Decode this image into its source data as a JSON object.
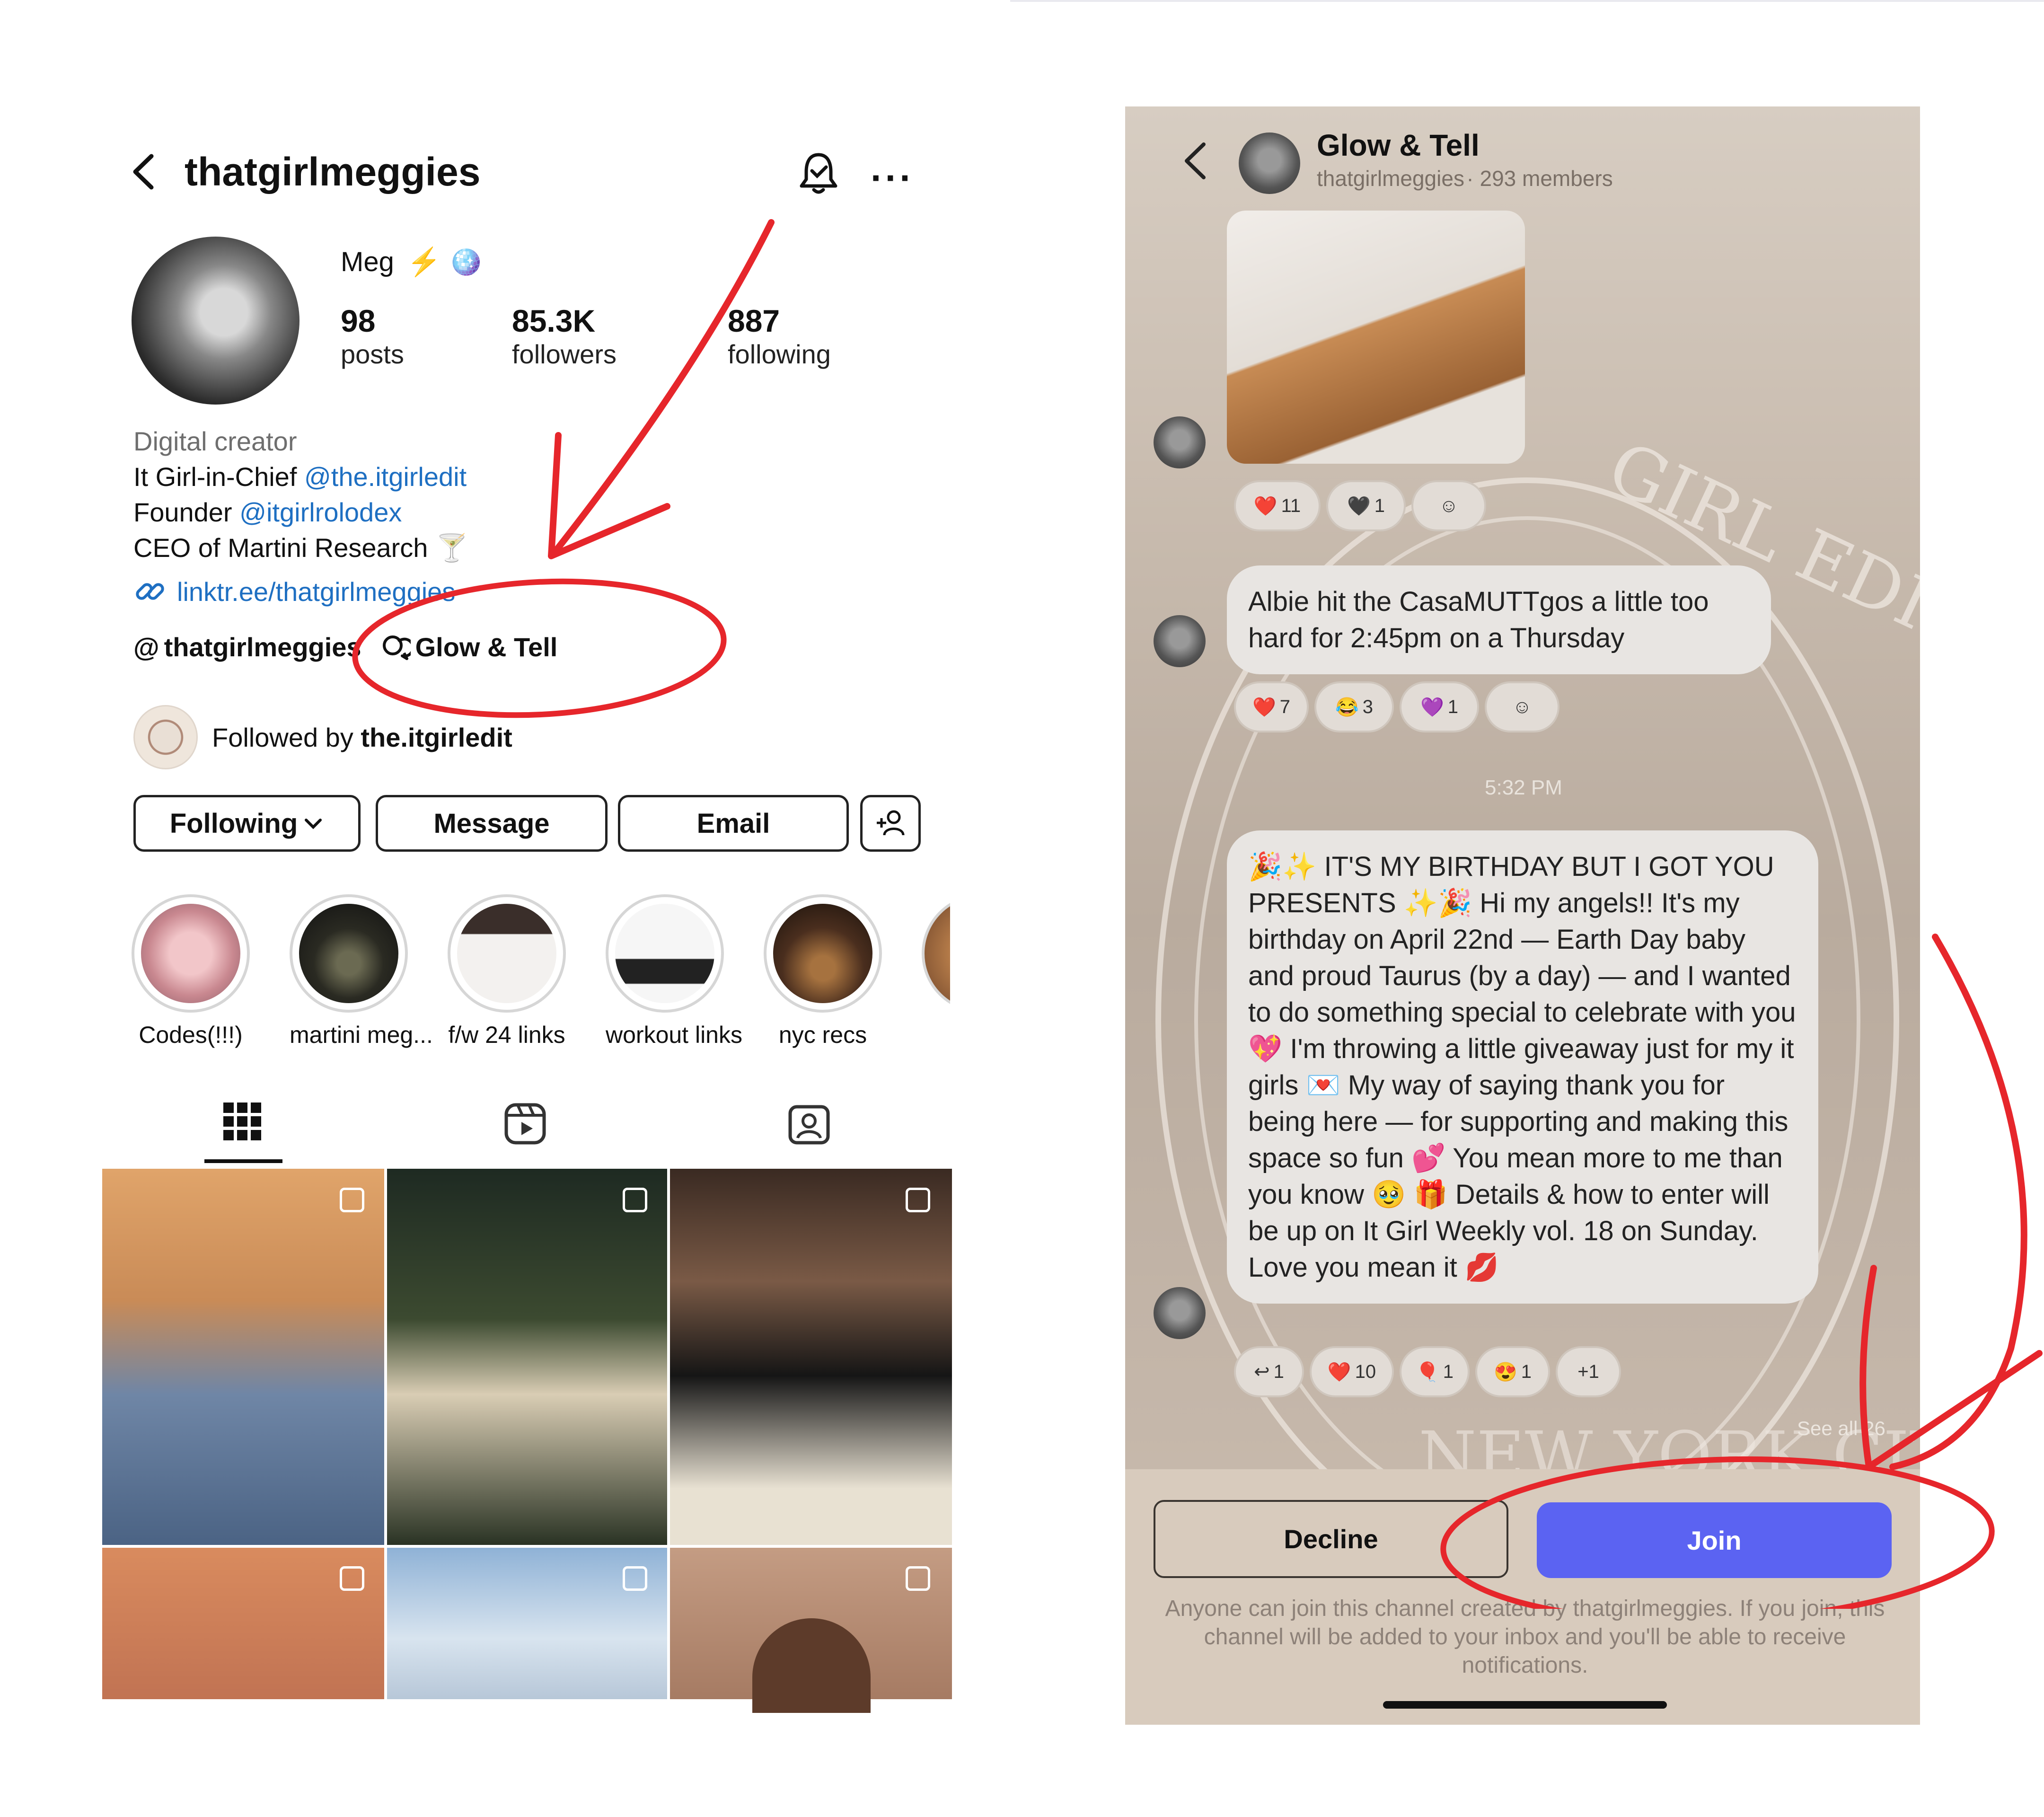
{
  "profile": {
    "username": "thatgirlmeggies",
    "display_name": "Meg",
    "name_icons": "⚡ 🪩",
    "stats": [
      {
        "value": "98",
        "label": "posts"
      },
      {
        "value": "85.3K",
        "label": "followers"
      },
      {
        "value": "887",
        "label": "following"
      }
    ],
    "category": "Digital creator",
    "bio": [
      {
        "text": "It Girl-in-Chief ",
        "link": "@the.itgirledit"
      },
      {
        "text": "Founder ",
        "link": "@itgirlrolodex"
      },
      {
        "text": "CEO of Martini Research 🍸",
        "link": ""
      }
    ],
    "website": "linktr.ee/thatgirlmeggies",
    "threads_handle": "thatgirlmeggies",
    "channel_chip": "Glow & Tell",
    "followed_by_prefix": "Followed by ",
    "followed_by_name": "the.itgirledit",
    "buttons": {
      "following": "Following",
      "message": "Message",
      "email": "Email"
    },
    "highlights": [
      {
        "label": "Codes(!!!)"
      },
      {
        "label": "martini meg..."
      },
      {
        "label": "f/w 24 links"
      },
      {
        "label": "workout links"
      },
      {
        "label": "nyc recs"
      }
    ],
    "tabs": [
      "grid-icon",
      "reels-icon",
      "tagged-icon"
    ]
  },
  "channel": {
    "title": "Glow & Tell",
    "owner": "thatgirlmeggies",
    "members": "· 293 members",
    "message1": "Albie hit the CasaMUTTgos a little too hard for 2:45pm on a Thursday",
    "reactions_photo": [
      {
        "emoji": "❤️",
        "count": "11"
      },
      {
        "emoji": "🖤",
        "count": "1"
      },
      {
        "emoji": "☺",
        "count": ""
      }
    ],
    "reactions_msg1": [
      {
        "emoji": "❤️",
        "count": "7"
      },
      {
        "emoji": "😂",
        "count": "3"
      },
      {
        "emoji": "💜",
        "count": "1"
      },
      {
        "emoji": "☺",
        "count": ""
      }
    ],
    "timestamp": "5:32 PM",
    "message2": "🎉✨ IT'S MY BIRTHDAY BUT I GOT YOU PRESENTS ✨🎉 Hi my angels!! It's my birthday on April 22nd — Earth Day baby and proud Taurus (by a day) — and I wanted to do something special to celebrate with you 💖 I'm throwing a little giveaway just for my it girls 💌 My way of saying thank you for being here — for supporting and making this space so fun 💕 You mean more to me than you know 🥹 🎁 Details & how to enter will be up on It Girl Weekly vol. 18 on Sunday. Love you mean it 💋",
    "reactions_msg2": [
      {
        "emoji": "↩",
        "count": "1"
      },
      {
        "emoji": "❤️",
        "count": "10"
      },
      {
        "emoji": "🎈",
        "count": "1"
      },
      {
        "emoji": "😍",
        "count": "1"
      },
      {
        "emoji": "",
        "count": "+1"
      }
    ],
    "see_all": "See all 26",
    "decline": "Decline",
    "join": "Join",
    "disclaimer": "Anyone can join this channel created by thatgirlmeggies. If you join, this channel will be added to your inbox and you'll be able to receive notifications."
  },
  "colors": {
    "annotation_red": "#e6262b",
    "join_blue": "#5b63f2",
    "link_blue": "#1e6fc2"
  }
}
